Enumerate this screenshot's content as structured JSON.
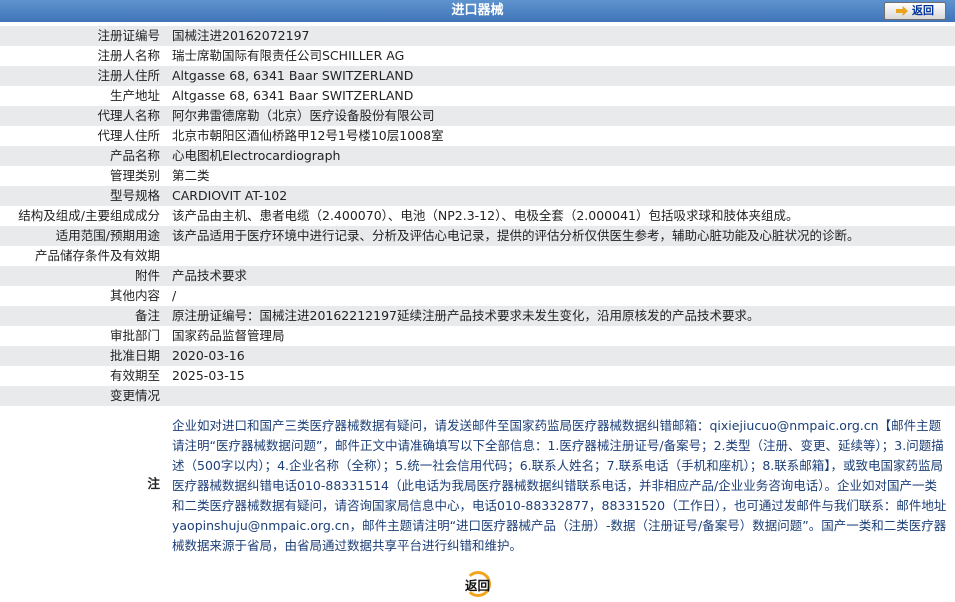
{
  "header": {
    "title": "进口器械",
    "back_label": "返回"
  },
  "fields": [
    {
      "label": "注册证编号",
      "value": "国械注进20162072197"
    },
    {
      "label": "注册人名称",
      "value": "瑞士席勒国际有限责任公司SCHILLER AG"
    },
    {
      "label": "注册人住所",
      "value": "Altgasse 68, 6341 Baar SWITZERLAND"
    },
    {
      "label": "生产地址",
      "value": "Altgasse 68, 6341 Baar SWITZERLAND"
    },
    {
      "label": "代理人名称",
      "value": "阿尔弗雷德席勒（北京）医疗设备股份有限公司"
    },
    {
      "label": "代理人住所",
      "value": "北京市朝阳区酒仙桥路甲12号1号楼10层1008室"
    },
    {
      "label": "产品名称",
      "value": "心电图机Electrocardiograph"
    },
    {
      "label": "管理类别",
      "value": "第二类"
    },
    {
      "label": "型号规格",
      "value": "CARDIOVIT AT-102"
    },
    {
      "label": "结构及组成/主要组成成分",
      "value": "该产品由主机、患者电缆（2.400070）、电池（NP2.3-12）、电极全套（2.000041）包括吸求球和肢体夹组成。"
    },
    {
      "label": "适用范围/预期用途",
      "value": "该产品适用于医疗环境中进行记录、分析及评估心电记录，提供的评估分析仅供医生参考，辅助心脏功能及心脏状况的诊断。"
    },
    {
      "label": "产品储存条件及有效期",
      "value": ""
    },
    {
      "label": "附件",
      "value": "产品技术要求"
    },
    {
      "label": "其他内容",
      "value": "/"
    },
    {
      "label": "备注",
      "value": "原注册证编号：国械注进20162212197延续注册产品技术要求未发生变化，沿用原核发的产品技术要求。"
    },
    {
      "label": "审批部门",
      "value": "国家药品监督管理局"
    },
    {
      "label": "批准日期",
      "value": "2020-03-16"
    },
    {
      "label": "有效期至",
      "value": "2025-03-15"
    },
    {
      "label": "变更情况",
      "value": ""
    }
  ],
  "note": {
    "label": "注",
    "text": "企业如对进口和国产三类医疗器械数据有疑问，请发送邮件至国家药监局医疗器械数据纠错邮箱：qixiejiucuo@nmpaic.org.cn【邮件主题请注明“医疗器械数据问题”，邮件正文中请准确填写以下全部信息：1.医疗器械注册证号/备案号；2.类型（注册、变更、延续等）；3.问题描述（500字以内）；4.企业名称（全称）；5.统一社会信用代码；6.联系人姓名；7.联系电话（手机和座机）；8.联系邮箱】，或致电国家药监局医疗器械数据纠错电话010-88331514（此电话为我局医疗器械数据纠错联系电话，并非相应产品/企业业务咨询电话）。企业如对国产一类和二类医疗器械数据有疑问，请咨询国家局信息中心，电话010-88332877，88331520（工作日），也可通过发邮件与我们联系：邮件地址yaopinshuju@nmpaic.org.cn，邮件主题请注明“进口医疗器械产品（注册）-数据（注册证号/备案号）数据问题”。国产一类和二类医疗器械数据来源于省局，由省局通过数据共享平台进行纠错和维护。"
  },
  "footer": {
    "back_label": "返回"
  }
}
